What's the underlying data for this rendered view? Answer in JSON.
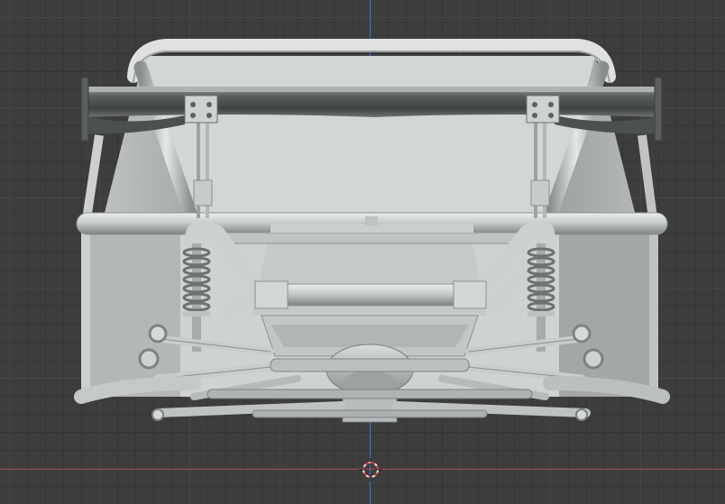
{
  "viewport": {
    "type": "3d-viewport",
    "view": "front",
    "colors": {
      "background": "#3d3d3d",
      "grid_minor": "#353535",
      "grid_major": "#474747",
      "axis_x": "#a3434c",
      "axis_y": "#4a73b6",
      "model_light": "#d3d5d5",
      "model_mid": "#b2b5b5",
      "model_dark": "#6f7373",
      "model_outline": "#8b8f8f"
    },
    "icons": {
      "cursor": "3d-cursor-icon"
    }
  }
}
